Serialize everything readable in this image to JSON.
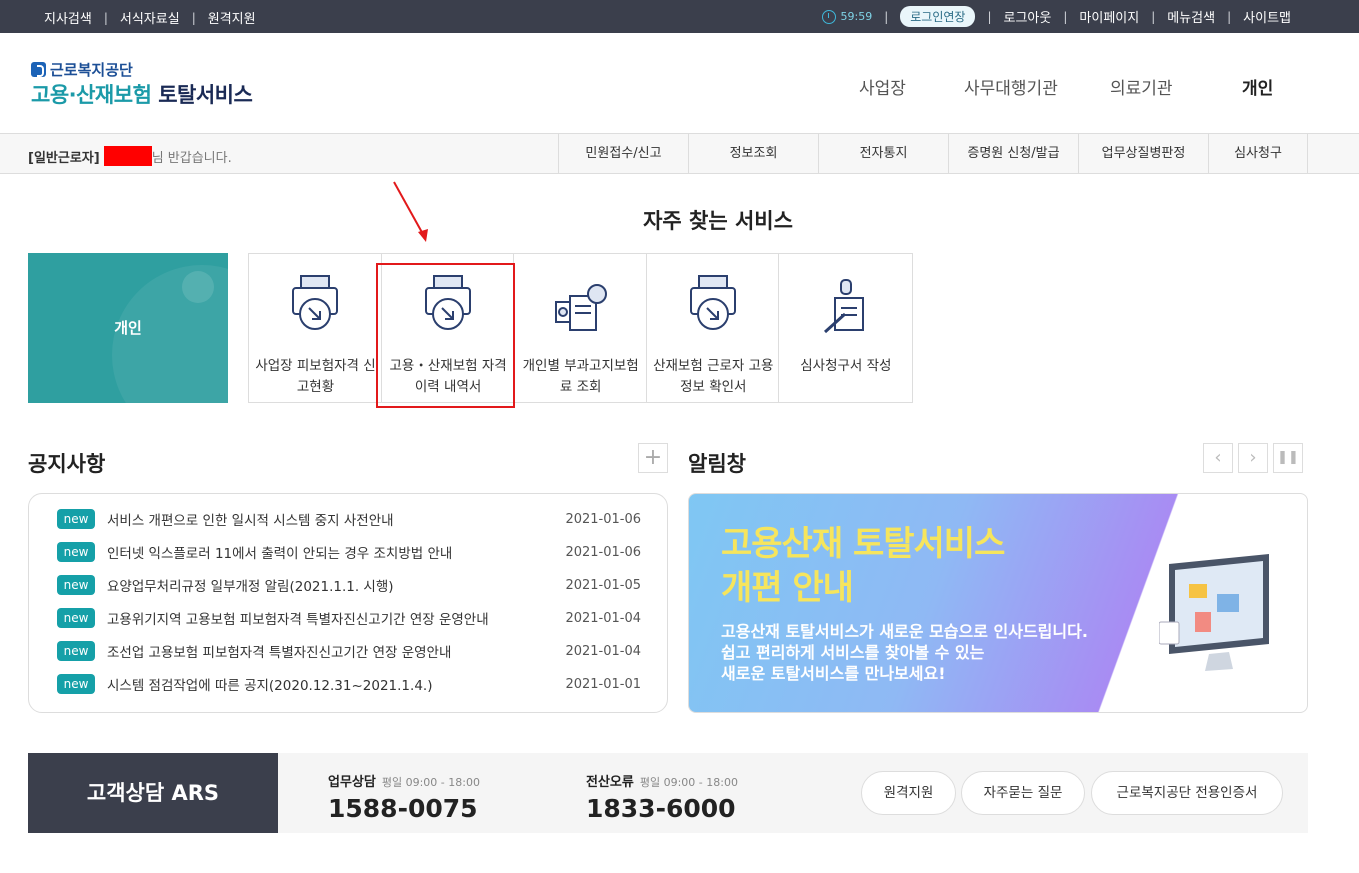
{
  "topbar": {
    "links_left": [
      "지사검색",
      "서식자료실",
      "원격지원"
    ],
    "timer": "59:59",
    "extend_login": "로그인연장",
    "links_right": [
      "로그아웃",
      "마이페이지",
      "메뉴검색",
      "사이트맵"
    ]
  },
  "header": {
    "org_name": "근로복지공단",
    "service_name_highlight": "고용·산재보험",
    "service_name_rest": "토탈서비스",
    "nav": [
      "사업장",
      "사무대행기관",
      "의료기관",
      "개인"
    ]
  },
  "subbar": {
    "user_type": "[일반근로자]",
    "greeting": "님 반갑습니다.",
    "menu": [
      "민원접수/신고",
      "정보조회",
      "전자통지",
      "증명원 신청/발급",
      "업무상질병판정",
      "심사청구"
    ]
  },
  "favorites": {
    "title": "자주 찾는 서비스",
    "tile_label": "개인",
    "services": [
      {
        "label": "사업장 피보험자격 신고현황",
        "icon": "printer-download-icon"
      },
      {
        "label": "고용・산재보험 자격 이력 내역서",
        "icon": "printer-download-icon"
      },
      {
        "label": "개인별 부과고지보험료 조회",
        "icon": "document-search-icon"
      },
      {
        "label": "산재보험 근로자 고용정보 확인서",
        "icon": "printer-download-icon"
      },
      {
        "label": "심사청구서 작성",
        "icon": "pen-document-icon"
      }
    ]
  },
  "notices": {
    "title": "공지사항",
    "more": "+",
    "items": [
      {
        "badge": "new",
        "text": "서비스 개편으로 인한 일시적 시스템 중지 사전안내",
        "date": "2021-01-06"
      },
      {
        "badge": "new",
        "text": "인터넷 익스플로러 11에서 출력이 안되는 경우 조치방법 안내",
        "date": "2021-01-06"
      },
      {
        "badge": "new",
        "text": "요양업무처리규정 일부개정 알림(2021.1.1. 시행)",
        "date": "2021-01-05"
      },
      {
        "badge": "new",
        "text": "고용위기지역 고용보험 피보험자격 특별자진신고기간 연장 운영안내",
        "date": "2021-01-04"
      },
      {
        "badge": "new",
        "text": "조선업 고용보험 피보험자격 특별자진신고기간 연장 운영안내",
        "date": "2021-01-04"
      },
      {
        "badge": "new",
        "text": "시스템 점검작업에 따른 공지(2020.12.31~2021.1.4.)",
        "date": "2021-01-01"
      }
    ]
  },
  "alerts": {
    "title": "알림창",
    "banner_title1": "고용산재 토탈서비스",
    "banner_title2": "개편 안내",
    "banner_lines": [
      "고용산재 토탈서비스가 새로운 모습으로 인사드립니다.",
      "쉽고 편리하게 서비스를 찾아볼 수 있는",
      "새로운 토탈서비스를 만나보세요!"
    ]
  },
  "footer": {
    "ars_label": "고객상담 ARS",
    "contacts": [
      {
        "label": "업무상담",
        "hours": "평일 09:00 - 18:00",
        "number": "1588-0075"
      },
      {
        "label": "전산오류",
        "hours": "평일 09:00 - 18:00",
        "number": "1833-6000"
      }
    ],
    "buttons": [
      "원격지원",
      "자주묻는 질문",
      "근로복지공단 전용인증서"
    ]
  },
  "colors": {
    "accent": "#15a0a8",
    "dark": "#3b3f4c",
    "highlight_box": "#e2191b",
    "banner_title": "#f6e55d"
  }
}
